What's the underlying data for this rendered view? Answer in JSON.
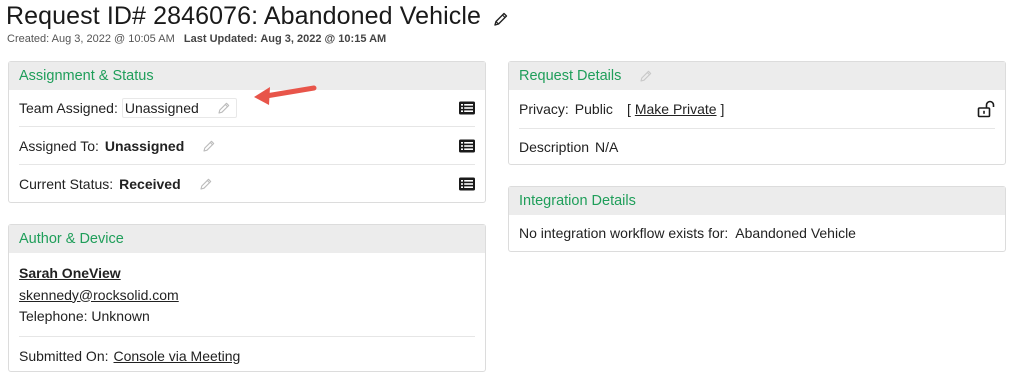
{
  "page": {
    "title": "Request ID# 2846076: Abandoned Vehicle",
    "created_label": "Created:",
    "created_value": "Aug 3, 2022 @ 10:05 AM",
    "updated_label": "Last Updated:",
    "updated_value": "Aug 3, 2022 @ 10:15 AM"
  },
  "assignment": {
    "header": "Assignment & Status",
    "team_label": "Team Assigned:",
    "team_value": "Unassigned",
    "assigned_label": "Assigned To:",
    "assigned_value": "Unassigned",
    "status_label": "Current Status:",
    "status_value": "Received"
  },
  "author": {
    "header": "Author & Device",
    "name": "Sarah OneView",
    "email": "skennedy@rocksolid.com",
    "telephone": "Telephone: Unknown",
    "submitted_label": "Submitted On:",
    "submitted_value": "Console via Meeting"
  },
  "request_details": {
    "header": "Request Details",
    "privacy_label": "Privacy:",
    "privacy_value": "Public",
    "bracket_open": "[",
    "make_private": "Make Private",
    "bracket_close": "]",
    "description_label": "Description",
    "description_value": "N/A"
  },
  "integration": {
    "header": "Integration Details",
    "message": "No integration workflow exists for:  Abandoned Vehicle"
  },
  "colors": {
    "accent_green": "#1f9e5a",
    "header_bg": "#ececec",
    "arrow": "#e8554a"
  },
  "icons": [
    "pencil-icon",
    "list-icon",
    "unlock-icon",
    "annotation-arrow"
  ]
}
